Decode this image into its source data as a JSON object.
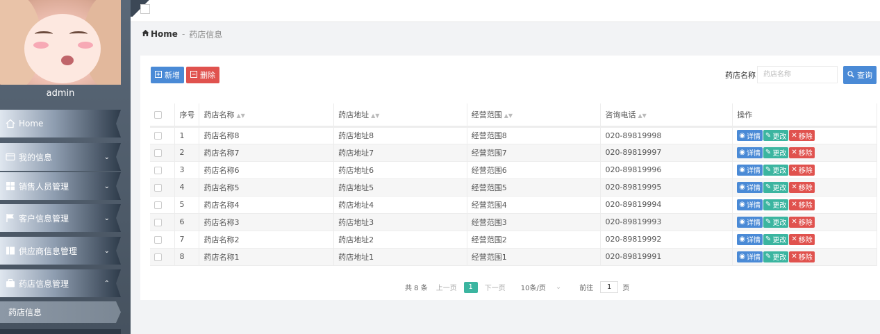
{
  "sidebar": {
    "username": "admin",
    "menu": [
      {
        "label": "Home",
        "icon": "home-icon"
      },
      {
        "label": "我的信息",
        "icon": "card-icon"
      },
      {
        "label": "销售人员管理",
        "icon": "grid-icon"
      },
      {
        "label": "客户信息管理",
        "icon": "flag-icon"
      },
      {
        "label": "供应商信息管理",
        "icon": "book-icon"
      },
      {
        "label": "药店信息管理",
        "icon": "briefcase-icon"
      }
    ],
    "submenu": "药店信息"
  },
  "breadcrumb": {
    "home": "Home",
    "sep": "-",
    "current": "药店信息"
  },
  "toolbar": {
    "add_label": "新增",
    "delete_label": "删除",
    "search_label": "药店名称",
    "search_placeholder": "药店名称",
    "search_button": "查询"
  },
  "table": {
    "headers": [
      "序号",
      "药店名称",
      "药店地址",
      "经营范围",
      "咨询电话",
      "操作"
    ],
    "rows": [
      [
        "1",
        "药店名称8",
        "药店地址8",
        "经营范围8",
        "020-89819998"
      ],
      [
        "2",
        "药店名称7",
        "药店地址7",
        "经营范围7",
        "020-89819997"
      ],
      [
        "3",
        "药店名称6",
        "药店地址6",
        "经营范围6",
        "020-89819996"
      ],
      [
        "4",
        "药店名称5",
        "药店地址5",
        "经营范围5",
        "020-89819995"
      ],
      [
        "5",
        "药店名称4",
        "药店地址4",
        "经营范围4",
        "020-89819994"
      ],
      [
        "6",
        "药店名称3",
        "药店地址3",
        "经营范围3",
        "020-89819993"
      ],
      [
        "7",
        "药店名称2",
        "药店地址2",
        "经营范围2",
        "020-89819992"
      ],
      [
        "8",
        "药店名称1",
        "药店地址1",
        "经营范围1",
        "020-89819991"
      ]
    ],
    "actions": {
      "detail": "详情",
      "edit": "更改",
      "remove": "移除"
    }
  },
  "pagination": {
    "total": "共 8 条",
    "prev": "上一页",
    "current_page": "1",
    "next": "下一页",
    "page_size": "10条/页",
    "goto_label": "前往",
    "goto_value": "1",
    "page_suffix": "页"
  },
  "colors": {
    "primary": "#4a8ad6",
    "danger": "#e0524e",
    "success": "#3bb5a0"
  }
}
